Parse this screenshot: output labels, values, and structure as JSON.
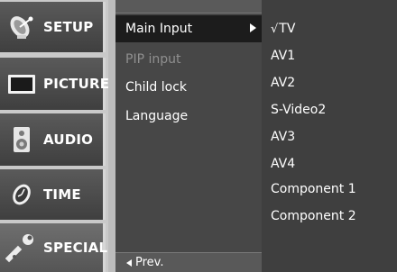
{
  "sidebar": {
    "items": [
      {
        "label": "SETUP",
        "icon": "satellite-dish-icon"
      },
      {
        "label": "PICTURE",
        "icon": "tv-screen-icon"
      },
      {
        "label": "AUDIO",
        "icon": "speaker-icon"
      },
      {
        "label": "TIME",
        "icon": "clock-icon"
      },
      {
        "label": "SPECIAL",
        "icon": "wrench-icon",
        "active": true
      }
    ]
  },
  "submenu": {
    "items": [
      {
        "label": "Main Input",
        "state": "selected",
        "has_submenu": true
      },
      {
        "label": "PIP input",
        "state": "disabled"
      },
      {
        "label": "Child lock",
        "state": "normal"
      },
      {
        "label": "Language",
        "state": "normal"
      }
    ],
    "prev_label": "Prev."
  },
  "options": {
    "check_mark": "√",
    "items": [
      {
        "label": "TV",
        "checked": true
      },
      {
        "label": "AV1"
      },
      {
        "label": "AV2"
      },
      {
        "label": "S-Video2"
      },
      {
        "label": "AV3"
      },
      {
        "label": "AV4"
      },
      {
        "label": "Component 1"
      },
      {
        "label": "Component 2"
      }
    ]
  }
}
